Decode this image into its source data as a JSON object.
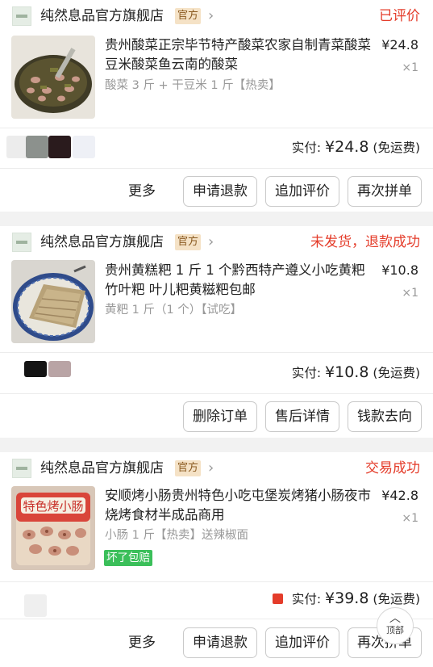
{
  "orders": [
    {
      "shop_name": "纯然息品官方旗舰店",
      "shop_badge": "官方",
      "status": "已评价",
      "product_title": "贵州酸菜正宗毕节特产酸菜农家自制青菜酸菜豆米酸菜鱼云南的酸菜",
      "sku": "酸菜 3 斤 + 干豆米 1 斤【热卖】",
      "price": "¥24.8",
      "qty": "×1",
      "paid_label": "实付:",
      "paid_amount": "¥24.8",
      "shipping": "(免运费)",
      "more_label": "更多",
      "buttons": [
        "申请退款",
        "追加评价",
        "再次拼单"
      ]
    },
    {
      "shop_name": "纯然息品官方旗舰店",
      "shop_badge": "官方",
      "status": "未发货，退款成功",
      "product_title": "贵州黄糕粑 1 斤 1 个黔西特产遵义小吃黄粑竹叶粑 叶儿粑黄糍粑包邮",
      "sku": "黄粑 1 斤（1 个）【试吃】",
      "price": "¥10.8",
      "qty": "×1",
      "paid_label": "实付:",
      "paid_amount": "¥10.8",
      "shipping": "(免运费)",
      "buttons": [
        "删除订单",
        "售后详情",
        "钱款去向"
      ]
    },
    {
      "shop_name": "纯然息品官方旗舰店",
      "shop_badge": "官方",
      "status": "交易成功",
      "product_title": "安顺烤小肠贵州特色小吃屯堡炭烤猪小肠夜市烧烤食材半成品商用",
      "sku": "小肠 1 斤【热卖】送辣椒面",
      "tag": "坏了包赔",
      "product_image_text": "特色烤小肠",
      "price": "¥42.8",
      "qty": "×1",
      "paid_label": "实付:",
      "paid_amount": "¥39.8",
      "shipping": "(免运费)",
      "more_label": "更多",
      "buttons": [
        "申请退款",
        "追加评价",
        "再次拼单"
      ]
    }
  ],
  "top_button": {
    "arrow": "︿",
    "label": "顶部"
  },
  "colors": {
    "status_red": "#e43c2a",
    "badge_bg": "#f5e2c6",
    "green_tag": "#3bbf5a"
  }
}
